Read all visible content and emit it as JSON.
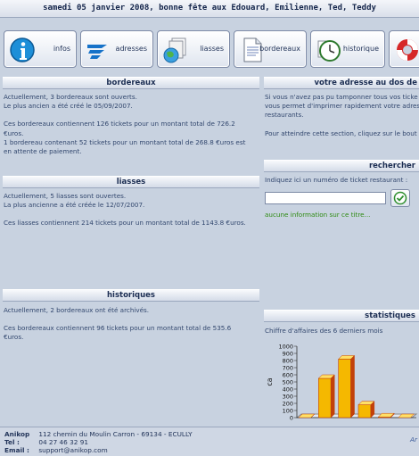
{
  "header": {
    "date_line": "samedi 05 janvier 2008, bonne fête aux Edouard, Emilienne, Ted, Teddy"
  },
  "nav": {
    "infos": "infos",
    "adresses": "adresses",
    "liasses": "liasses",
    "bordereaux": "bordereaux",
    "historique": "historique"
  },
  "bordereaux": {
    "title": "bordereaux",
    "line1": "Actuellement, 3 bordereaux sont ouverts.",
    "line2": "Le plus ancien a été créé le 05/09/2007.",
    "line3": "Ces bordereaux contiennent 126 tickets pour un montant total de 726.2",
    "line4": "€uros.",
    "line5": "1 bordereau contenant 52 tickets pour un montant total de 268.8 €uros est",
    "line6": "en attente de paiement."
  },
  "liasses": {
    "title": "liasses",
    "line1": "Actuellement, 5 liasses sont ouvertes.",
    "line2": "La plus ancienne a été créée le 12/07/2007.",
    "line3": "Ces liasses contiennent 214 tickets pour un montant total de 1143.8 €uros."
  },
  "historiques": {
    "title": "historiques",
    "line1": "Actuellement, 2 bordereaux ont été archivés.",
    "line2": "Ces bordereaux contiennent 96 tickets pour un montant total de 535.6",
    "line3": "€uros."
  },
  "adresse": {
    "title": "votre adresse au dos de",
    "line1": "Si vous n'avez pas pu tamponner tous vos ticke",
    "line2": "vous permet d'imprimer rapidement votre adres",
    "line3": "restaurants.",
    "line4": "Pour atteindre cette section, cliquez sur le bout"
  },
  "search": {
    "title": "rechercher",
    "prompt": "Indiquez ici un numéro de ticket restaurant :",
    "value": "",
    "message": "aucune information sur ce titre..."
  },
  "stats": {
    "title": "statistiques",
    "subtitle": "Chiffre d'affaires des 6 derniers mois"
  },
  "chart_data": {
    "type": "bar",
    "title": "",
    "xlabel": "",
    "ylabel": "ca",
    "ylim": [
      0,
      1000
    ],
    "yticks": [
      "0",
      "100",
      "200",
      "300",
      "400",
      "500",
      "600",
      "700",
      "800",
      "900",
      "1000"
    ],
    "categories": [
      "",
      "",
      "",
      "",
      "",
      ""
    ],
    "values": [
      0,
      550,
      820,
      180,
      10,
      0
    ],
    "colors": {
      "bar": "#f5b800",
      "bar_dark": "#c2410a",
      "bar_light": "#ffe066"
    }
  },
  "footer": {
    "company_label": "Anikop",
    "address": "112 chemin du Moulin Carron - 69134 - ECULLY",
    "tel_label": "Tel :",
    "tel": "04 27 46 32 91",
    "email_label": "Email :",
    "email": "support@anikop.com",
    "right_fragment": "Ar"
  }
}
